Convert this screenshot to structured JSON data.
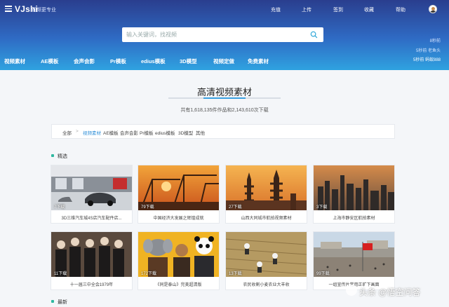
{
  "header": {
    "logo": "VJshi",
    "slogan": "视频更专业",
    "nav": [
      "充值",
      "上传",
      "签到",
      "收藏",
      "帮助"
    ],
    "search_placeholder": "输入关键词，找视频",
    "ticker": [
      "8秒前",
      "5秒前 老鱼头",
      "5秒前 蚂蚁888"
    ],
    "categories": [
      "视频素材",
      "AE模板",
      "会声会影",
      "Pr模板",
      "edius模板",
      "3D模型",
      "视频定做",
      "免费素材"
    ]
  },
  "page": {
    "title": "高清视频素材",
    "subtitle": "共有1,618,135件作品和2,143,610次下载"
  },
  "breadcrumb": {
    "root": "全部",
    "separator": ">",
    "active": "视频素材",
    "items": [
      "AE模板",
      "会声会影",
      "Pr模板",
      "edius模板",
      "3D模型",
      "其他"
    ]
  },
  "sections": {
    "featured": "精选",
    "latest": "最新"
  },
  "cards": [
    {
      "count": "7下载",
      "caption": "3D三维汽车城4S店汽车配件店...",
      "thumb": "car-showroom"
    },
    {
      "count": "79下载",
      "caption": "中国经济大发展之辉煌成就",
      "thumb": "port-cranes"
    },
    {
      "count": "27下载",
      "caption": "山西大同城市航拍视频素材",
      "thumb": "pagoda-city"
    },
    {
      "count": "3下载",
      "caption": "上海市静安区航拍素材",
      "thumb": "city-skyline"
    },
    {
      "count": "11下载",
      "caption": "十一届三中全会1979年",
      "thumb": "historic-meeting"
    },
    {
      "count": "172下载",
      "caption": "《同是泰山》完美超清版",
      "thumb": "animal-masks"
    },
    {
      "count": "13下载",
      "caption": "农民收割小麦农业大丰收",
      "thumb": "wheat-harvest"
    },
    {
      "count": "99下载",
      "caption": "一组宣传片常用正旷下画面",
      "thumb": "square-flag"
    }
  ],
  "watermark": "头条 @悟空问答",
  "colors": {
    "header_top": "#2a3e8e",
    "header_bottom": "#2fa2e0",
    "accent": "#3aa0e0",
    "section_dot": "#2fb8a0"
  }
}
